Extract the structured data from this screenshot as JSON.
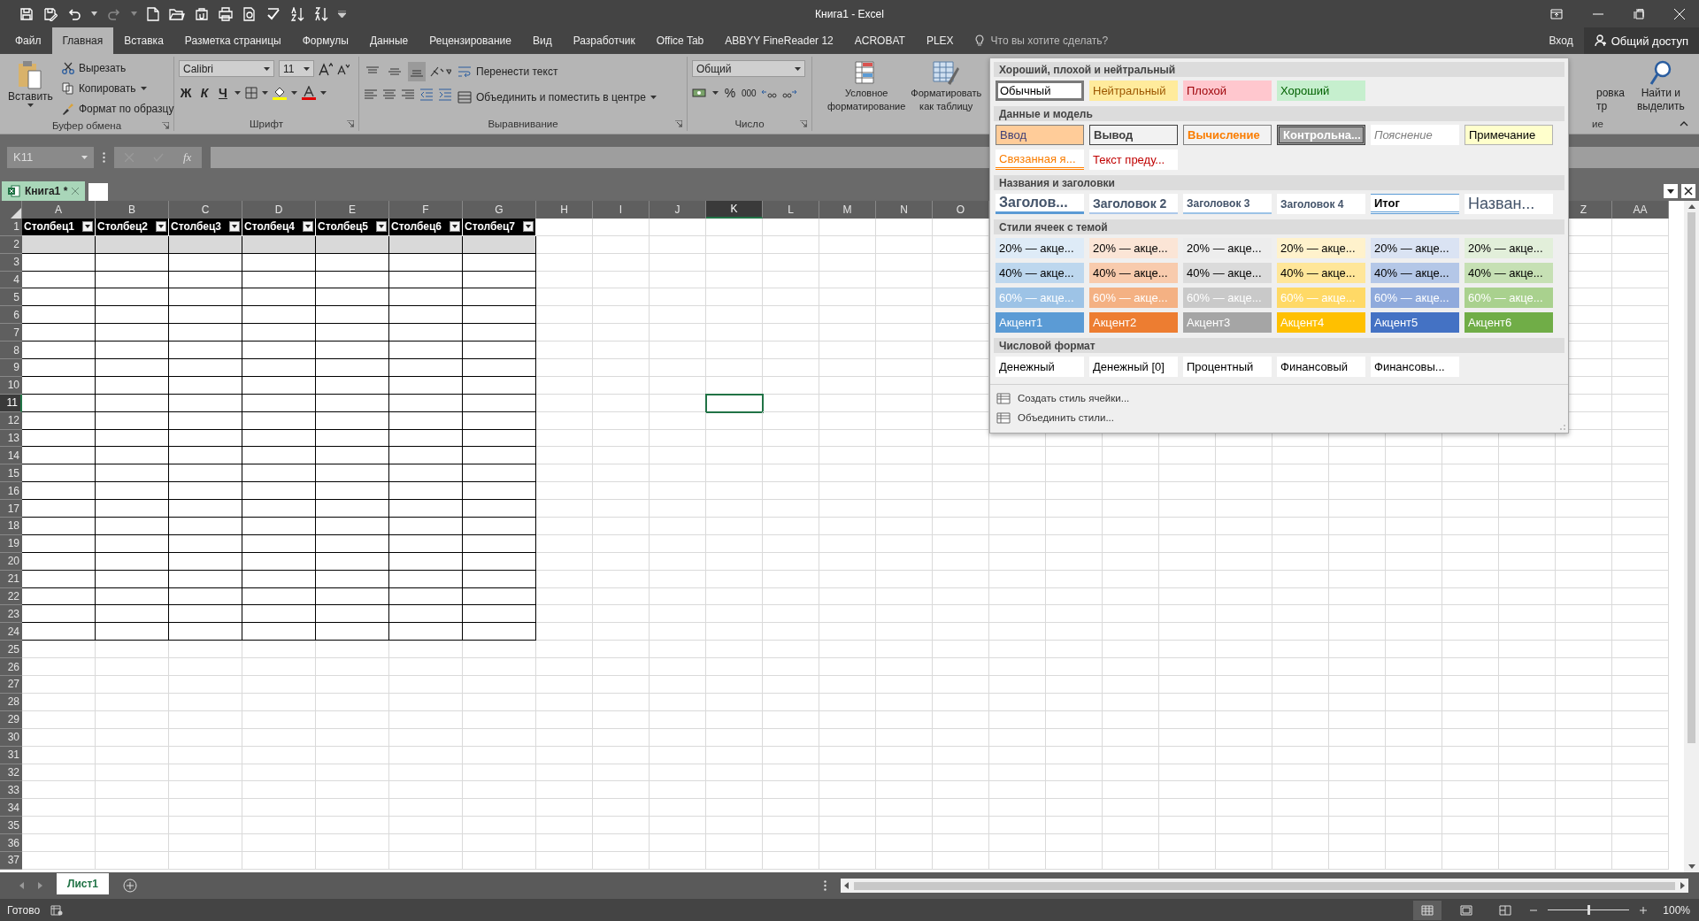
{
  "window": {
    "title": "Книга1 - Excel"
  },
  "ribbon_tabs": [
    {
      "label": "Файл",
      "selected": false
    },
    {
      "label": "Главная",
      "selected": true
    },
    {
      "label": "Вставка",
      "selected": false
    },
    {
      "label": "Разметка страницы",
      "selected": false
    },
    {
      "label": "Формулы",
      "selected": false
    },
    {
      "label": "Данные",
      "selected": false
    },
    {
      "label": "Рецензирование",
      "selected": false
    },
    {
      "label": "Вид",
      "selected": false
    },
    {
      "label": "Разработчик",
      "selected": false
    },
    {
      "label": "Office Tab",
      "selected": false
    },
    {
      "label": "ABBYY FineReader 12",
      "selected": false
    },
    {
      "label": "ACROBAT",
      "selected": false
    },
    {
      "label": "PLEX",
      "selected": false
    }
  ],
  "tell_me": {
    "placeholder": "Что вы хотите сделать?"
  },
  "sign_in": "Вход",
  "share": "Общий доступ",
  "clipboard": {
    "paste": "Вставить",
    "cut": "Вырезать",
    "copy": "Копировать",
    "format_painter": "Формат по образцу",
    "label": "Буфер обмена"
  },
  "font": {
    "name": "Calibri",
    "size": "11",
    "bold": "Ж",
    "italic": "К",
    "underline": "Ч",
    "label": "Шрифт"
  },
  "alignment": {
    "vertical": [
      {
        "selected": false
      },
      {
        "selected": false
      },
      {
        "selected": true
      }
    ],
    "wrap": "Перенести текст",
    "merge": "Объединить и поместить в центре",
    "label": "Выравнивание"
  },
  "number": {
    "format": "Общий",
    "percent": "%",
    "thousands": "000",
    "label": "Число"
  },
  "styles": {
    "conditional": [
      "Условное",
      "форматирование"
    ],
    "format_table": [
      "Форматировать",
      "как таблицу"
    ]
  },
  "editing": {
    "sort": [
      "ровка",
      "тр"
    ],
    "find": [
      "Найти и",
      "выделить"
    ],
    "label": "ие"
  },
  "formula_bar": {
    "name_box": "K11",
    "fx": "fx"
  },
  "workbook_tabs": [
    {
      "label": "Книга1 *",
      "selected": true
    }
  ],
  "sheet": {
    "columns_left": [
      {
        "label": "A",
        "selected": false
      },
      {
        "label": "B",
        "selected": false
      },
      {
        "label": "C",
        "selected": false
      },
      {
        "label": "D",
        "selected": false
      },
      {
        "label": "E",
        "selected": false
      },
      {
        "label": "F",
        "selected": false
      },
      {
        "label": "G",
        "selected": false
      },
      {
        "label": "H",
        "selected": false
      },
      {
        "label": "I",
        "selected": false
      },
      {
        "label": "J",
        "selected": false
      },
      {
        "label": "K",
        "selected": true
      },
      {
        "label": "L",
        "selected": false
      },
      {
        "label": "M",
        "selected": false
      },
      {
        "label": "N",
        "selected": false
      },
      {
        "label": "O",
        "selected": false
      }
    ],
    "columns_right": [
      {
        "label": "Z",
        "selected": false
      },
      {
        "label": "AA",
        "selected": false
      }
    ],
    "table_headers": [
      "Столбец1",
      "Столбец2",
      "Столбец3",
      "Столбец4",
      "Столбец5",
      "Столбец6",
      "Столбец7"
    ],
    "rows": [
      {
        "label": "1",
        "kind": "header",
        "selected": false
      },
      {
        "label": "2",
        "kind": "shaded",
        "selected": false
      },
      {
        "label": "3",
        "kind": "body",
        "selected": false
      },
      {
        "label": "4",
        "kind": "body",
        "selected": false
      },
      {
        "label": "5",
        "kind": "body",
        "selected": false
      },
      {
        "label": "6",
        "kind": "body",
        "selected": false
      },
      {
        "label": "7",
        "kind": "body",
        "selected": false
      },
      {
        "label": "8",
        "kind": "body",
        "selected": false
      },
      {
        "label": "9",
        "kind": "body",
        "selected": false
      },
      {
        "label": "10",
        "kind": "body",
        "selected": false
      },
      {
        "label": "11",
        "kind": "body",
        "selected": true
      },
      {
        "label": "12",
        "kind": "body",
        "selected": false
      },
      {
        "label": "13",
        "kind": "body",
        "selected": false
      },
      {
        "label": "14",
        "kind": "body",
        "selected": false
      },
      {
        "label": "15",
        "kind": "body",
        "selected": false
      },
      {
        "label": "16",
        "kind": "body",
        "selected": false
      },
      {
        "label": "17",
        "kind": "body",
        "selected": false
      },
      {
        "label": "18",
        "kind": "body",
        "selected": false
      },
      {
        "label": "19",
        "kind": "body",
        "selected": false
      },
      {
        "label": "20",
        "kind": "body",
        "selected": false
      },
      {
        "label": "21",
        "kind": "body",
        "selected": false
      },
      {
        "label": "22",
        "kind": "body",
        "selected": false
      },
      {
        "label": "23",
        "kind": "body",
        "selected": false
      },
      {
        "label": "24",
        "kind": "body",
        "selected": false
      },
      {
        "label": "25",
        "kind": "none",
        "selected": false
      },
      {
        "label": "26",
        "kind": "none",
        "selected": false
      },
      {
        "label": "27",
        "kind": "none",
        "selected": false
      },
      {
        "label": "28",
        "kind": "none",
        "selected": false
      },
      {
        "label": "29",
        "kind": "none",
        "selected": false
      },
      {
        "label": "30",
        "kind": "none",
        "selected": false
      },
      {
        "label": "31",
        "kind": "none",
        "selected": false
      },
      {
        "label": "32",
        "kind": "none",
        "selected": false
      },
      {
        "label": "33",
        "kind": "none",
        "selected": false
      },
      {
        "label": "34",
        "kind": "none",
        "selected": false
      },
      {
        "label": "35",
        "kind": "none",
        "selected": false
      },
      {
        "label": "36",
        "kind": "none",
        "selected": false
      },
      {
        "label": "37",
        "kind": "none",
        "selected": false
      }
    ]
  },
  "cell_styles": {
    "sections": [
      {
        "title": "Хороший, плохой и нейтральный",
        "items": [
          {
            "label": "Обычный",
            "kind": "normal",
            "selected": true
          },
          {
            "label": "Нейтральный",
            "kind": "neutral",
            "selected": false
          },
          {
            "label": "Плохой",
            "kind": "bad",
            "selected": false
          },
          {
            "label": "Хороший",
            "kind": "good",
            "selected": false
          }
        ]
      },
      {
        "title": "Данные и модель",
        "items": [
          {
            "label": "Ввод",
            "kind": "input",
            "selected": false
          },
          {
            "label": "Вывод",
            "kind": "output",
            "selected": false
          },
          {
            "label": "Вычисление",
            "kind": "calc",
            "selected": false
          },
          {
            "label": "Контрольна...",
            "kind": "check",
            "selected": false
          },
          {
            "label": "Пояснение",
            "kind": "explanatory",
            "selected": false
          },
          {
            "label": "Примечание",
            "kind": "note",
            "selected": false
          },
          {
            "label": "Связанная я...",
            "kind": "linked",
            "selected": false
          },
          {
            "label": "Текст преду...",
            "kind": "warning",
            "selected": false
          }
        ]
      },
      {
        "title": "Названия и заголовки",
        "items": [
          {
            "label": "Заголов...",
            "kind": "heading1",
            "selected": false
          },
          {
            "label": "Заголовок 2",
            "kind": "heading2",
            "selected": false
          },
          {
            "label": "Заголовок 3",
            "kind": "heading3",
            "selected": false
          },
          {
            "label": "Заголовок 4",
            "kind": "heading4",
            "selected": false
          },
          {
            "label": "Итог",
            "kind": "total",
            "selected": false
          },
          {
            "label": "Назван...",
            "kind": "title",
            "selected": false
          }
        ]
      },
      {
        "title": "Стили ячеек с темой",
        "items": [
          {
            "label": "20% — акце...",
            "kind": "accent20",
            "color": "#deebf7",
            "selected": false
          },
          {
            "label": "20% — акце...",
            "kind": "accent20",
            "color": "#fbe5d6",
            "selected": false
          },
          {
            "label": "20% — акце...",
            "kind": "accent20",
            "color": "#ededed",
            "selected": false
          },
          {
            "label": "20% — акце...",
            "kind": "accent20",
            "color": "#fff2cc",
            "selected": false
          },
          {
            "label": "20% — акце...",
            "kind": "accent20",
            "color": "#dae3f3",
            "selected": false
          },
          {
            "label": "20% — акце...",
            "kind": "accent20",
            "color": "#e2efda",
            "selected": false
          },
          {
            "label": "40% — акце...",
            "kind": "accent40",
            "color": "#bdd7ee",
            "selected": false
          },
          {
            "label": "40% — акце...",
            "kind": "accent40",
            "color": "#f8cbad",
            "selected": false
          },
          {
            "label": "40% — акце...",
            "kind": "accent40",
            "color": "#dbdbdb",
            "selected": false
          },
          {
            "label": "40% — акце...",
            "kind": "accent40",
            "color": "#ffe699",
            "selected": false
          },
          {
            "label": "40% — акце...",
            "kind": "accent40",
            "color": "#b4c7e7",
            "selected": false
          },
          {
            "label": "40% — акце...",
            "kind": "accent40",
            "color": "#c6e0b4",
            "selected": false
          },
          {
            "label": "60% — акце...",
            "kind": "accent60",
            "color": "#9dc3e6",
            "selected": false
          },
          {
            "label": "60% — акце...",
            "kind": "accent60",
            "color": "#f4b183",
            "selected": false
          },
          {
            "label": "60% — акце...",
            "kind": "accent60",
            "color": "#c9c9c9",
            "selected": false
          },
          {
            "label": "60% — акце...",
            "kind": "accent60",
            "color": "#ffd966",
            "selected": false
          },
          {
            "label": "60% — акце...",
            "kind": "accent60",
            "color": "#8faadc",
            "selected": false
          },
          {
            "label": "60% — акце...",
            "kind": "accent60",
            "color": "#a9d18e",
            "selected": false
          },
          {
            "label": "Акцент1",
            "kind": "accent",
            "color": "#5b9bd5",
            "selected": false
          },
          {
            "label": "Акцент2",
            "kind": "accent",
            "color": "#ed7d31",
            "selected": false
          },
          {
            "label": "Акцент3",
            "kind": "accent",
            "color": "#a5a5a5",
            "selected": false
          },
          {
            "label": "Акцент4",
            "kind": "accent",
            "color": "#ffc000",
            "selected": false
          },
          {
            "label": "Акцент5",
            "kind": "accent",
            "color": "#4472c4",
            "selected": false
          },
          {
            "label": "Акцент6",
            "kind": "accent",
            "color": "#70ad47",
            "selected": false
          }
        ]
      },
      {
        "title": "Числовой формат",
        "items": [
          {
            "label": "Денежный",
            "kind": "plain",
            "selected": false
          },
          {
            "label": "Денежный [0]",
            "kind": "plain",
            "selected": false
          },
          {
            "label": "Процентный",
            "kind": "plain",
            "selected": false
          },
          {
            "label": "Финансовый",
            "kind": "plain",
            "selected": false
          },
          {
            "label": "Финансовы...",
            "kind": "plain",
            "selected": false
          }
        ]
      }
    ],
    "actions": [
      "Создать стиль ячейки...",
      "Объединить стили..."
    ]
  },
  "sheet_tabs": [
    {
      "label": "Лист1",
      "selected": true
    }
  ],
  "status_bar": {
    "text": "Готово",
    "views": [
      {
        "selected": true
      },
      {
        "selected": false
      },
      {
        "selected": false
      }
    ],
    "zoom": {
      "level": 0.5,
      "reading": "100%"
    }
  }
}
